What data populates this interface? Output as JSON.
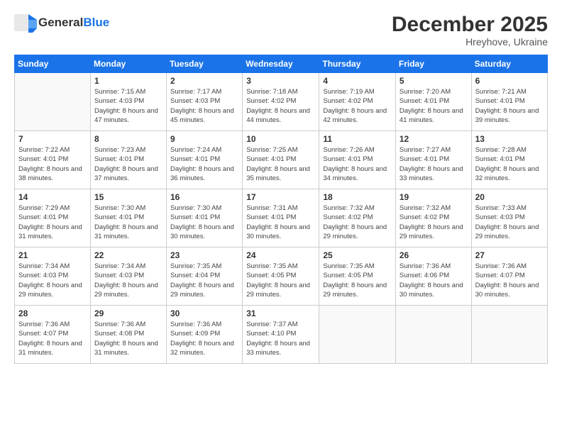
{
  "header": {
    "logo_general": "General",
    "logo_blue": "Blue",
    "month_title": "December 2025",
    "location": "Hreyhove, Ukraine"
  },
  "calendar": {
    "weekdays": [
      "Sunday",
      "Monday",
      "Tuesday",
      "Wednesday",
      "Thursday",
      "Friday",
      "Saturday"
    ],
    "weeks": [
      [
        {
          "day": "",
          "sunrise": "",
          "sunset": "",
          "daylight": ""
        },
        {
          "day": "1",
          "sunrise": "Sunrise: 7:15 AM",
          "sunset": "Sunset: 4:03 PM",
          "daylight": "Daylight: 8 hours and 47 minutes."
        },
        {
          "day": "2",
          "sunrise": "Sunrise: 7:17 AM",
          "sunset": "Sunset: 4:03 PM",
          "daylight": "Daylight: 8 hours and 45 minutes."
        },
        {
          "day": "3",
          "sunrise": "Sunrise: 7:18 AM",
          "sunset": "Sunset: 4:02 PM",
          "daylight": "Daylight: 8 hours and 44 minutes."
        },
        {
          "day": "4",
          "sunrise": "Sunrise: 7:19 AM",
          "sunset": "Sunset: 4:02 PM",
          "daylight": "Daylight: 8 hours and 42 minutes."
        },
        {
          "day": "5",
          "sunrise": "Sunrise: 7:20 AM",
          "sunset": "Sunset: 4:01 PM",
          "daylight": "Daylight: 8 hours and 41 minutes."
        },
        {
          "day": "6",
          "sunrise": "Sunrise: 7:21 AM",
          "sunset": "Sunset: 4:01 PM",
          "daylight": "Daylight: 8 hours and 39 minutes."
        }
      ],
      [
        {
          "day": "7",
          "sunrise": "Sunrise: 7:22 AM",
          "sunset": "Sunset: 4:01 PM",
          "daylight": "Daylight: 8 hours and 38 minutes."
        },
        {
          "day": "8",
          "sunrise": "Sunrise: 7:23 AM",
          "sunset": "Sunset: 4:01 PM",
          "daylight": "Daylight: 8 hours and 37 minutes."
        },
        {
          "day": "9",
          "sunrise": "Sunrise: 7:24 AM",
          "sunset": "Sunset: 4:01 PM",
          "daylight": "Daylight: 8 hours and 36 minutes."
        },
        {
          "day": "10",
          "sunrise": "Sunrise: 7:25 AM",
          "sunset": "Sunset: 4:01 PM",
          "daylight": "Daylight: 8 hours and 35 minutes."
        },
        {
          "day": "11",
          "sunrise": "Sunrise: 7:26 AM",
          "sunset": "Sunset: 4:01 PM",
          "daylight": "Daylight: 8 hours and 34 minutes."
        },
        {
          "day": "12",
          "sunrise": "Sunrise: 7:27 AM",
          "sunset": "Sunset: 4:01 PM",
          "daylight": "Daylight: 8 hours and 33 minutes."
        },
        {
          "day": "13",
          "sunrise": "Sunrise: 7:28 AM",
          "sunset": "Sunset: 4:01 PM",
          "daylight": "Daylight: 8 hours and 32 minutes."
        }
      ],
      [
        {
          "day": "14",
          "sunrise": "Sunrise: 7:29 AM",
          "sunset": "Sunset: 4:01 PM",
          "daylight": "Daylight: 8 hours and 31 minutes."
        },
        {
          "day": "15",
          "sunrise": "Sunrise: 7:30 AM",
          "sunset": "Sunset: 4:01 PM",
          "daylight": "Daylight: 8 hours and 31 minutes."
        },
        {
          "day": "16",
          "sunrise": "Sunrise: 7:30 AM",
          "sunset": "Sunset: 4:01 PM",
          "daylight": "Daylight: 8 hours and 30 minutes."
        },
        {
          "day": "17",
          "sunrise": "Sunrise: 7:31 AM",
          "sunset": "Sunset: 4:01 PM",
          "daylight": "Daylight: 8 hours and 30 minutes."
        },
        {
          "day": "18",
          "sunrise": "Sunrise: 7:32 AM",
          "sunset": "Sunset: 4:02 PM",
          "daylight": "Daylight: 8 hours and 29 minutes."
        },
        {
          "day": "19",
          "sunrise": "Sunrise: 7:32 AM",
          "sunset": "Sunset: 4:02 PM",
          "daylight": "Daylight: 8 hours and 29 minutes."
        },
        {
          "day": "20",
          "sunrise": "Sunrise: 7:33 AM",
          "sunset": "Sunset: 4:03 PM",
          "daylight": "Daylight: 8 hours and 29 minutes."
        }
      ],
      [
        {
          "day": "21",
          "sunrise": "Sunrise: 7:34 AM",
          "sunset": "Sunset: 4:03 PM",
          "daylight": "Daylight: 8 hours and 29 minutes."
        },
        {
          "day": "22",
          "sunrise": "Sunrise: 7:34 AM",
          "sunset": "Sunset: 4:03 PM",
          "daylight": "Daylight: 8 hours and 29 minutes."
        },
        {
          "day": "23",
          "sunrise": "Sunrise: 7:35 AM",
          "sunset": "Sunset: 4:04 PM",
          "daylight": "Daylight: 8 hours and 29 minutes."
        },
        {
          "day": "24",
          "sunrise": "Sunrise: 7:35 AM",
          "sunset": "Sunset: 4:05 PM",
          "daylight": "Daylight: 8 hours and 29 minutes."
        },
        {
          "day": "25",
          "sunrise": "Sunrise: 7:35 AM",
          "sunset": "Sunset: 4:05 PM",
          "daylight": "Daylight: 8 hours and 29 minutes."
        },
        {
          "day": "26",
          "sunrise": "Sunrise: 7:36 AM",
          "sunset": "Sunset: 4:06 PM",
          "daylight": "Daylight: 8 hours and 30 minutes."
        },
        {
          "day": "27",
          "sunrise": "Sunrise: 7:36 AM",
          "sunset": "Sunset: 4:07 PM",
          "daylight": "Daylight: 8 hours and 30 minutes."
        }
      ],
      [
        {
          "day": "28",
          "sunrise": "Sunrise: 7:36 AM",
          "sunset": "Sunset: 4:07 PM",
          "daylight": "Daylight: 8 hours and 31 minutes."
        },
        {
          "day": "29",
          "sunrise": "Sunrise: 7:36 AM",
          "sunset": "Sunset: 4:08 PM",
          "daylight": "Daylight: 8 hours and 31 minutes."
        },
        {
          "day": "30",
          "sunrise": "Sunrise: 7:36 AM",
          "sunset": "Sunset: 4:09 PM",
          "daylight": "Daylight: 8 hours and 32 minutes."
        },
        {
          "day": "31",
          "sunrise": "Sunrise: 7:37 AM",
          "sunset": "Sunset: 4:10 PM",
          "daylight": "Daylight: 8 hours and 33 minutes."
        },
        {
          "day": "",
          "sunrise": "",
          "sunset": "",
          "daylight": ""
        },
        {
          "day": "",
          "sunrise": "",
          "sunset": "",
          "daylight": ""
        },
        {
          "day": "",
          "sunrise": "",
          "sunset": "",
          "daylight": ""
        }
      ]
    ]
  }
}
